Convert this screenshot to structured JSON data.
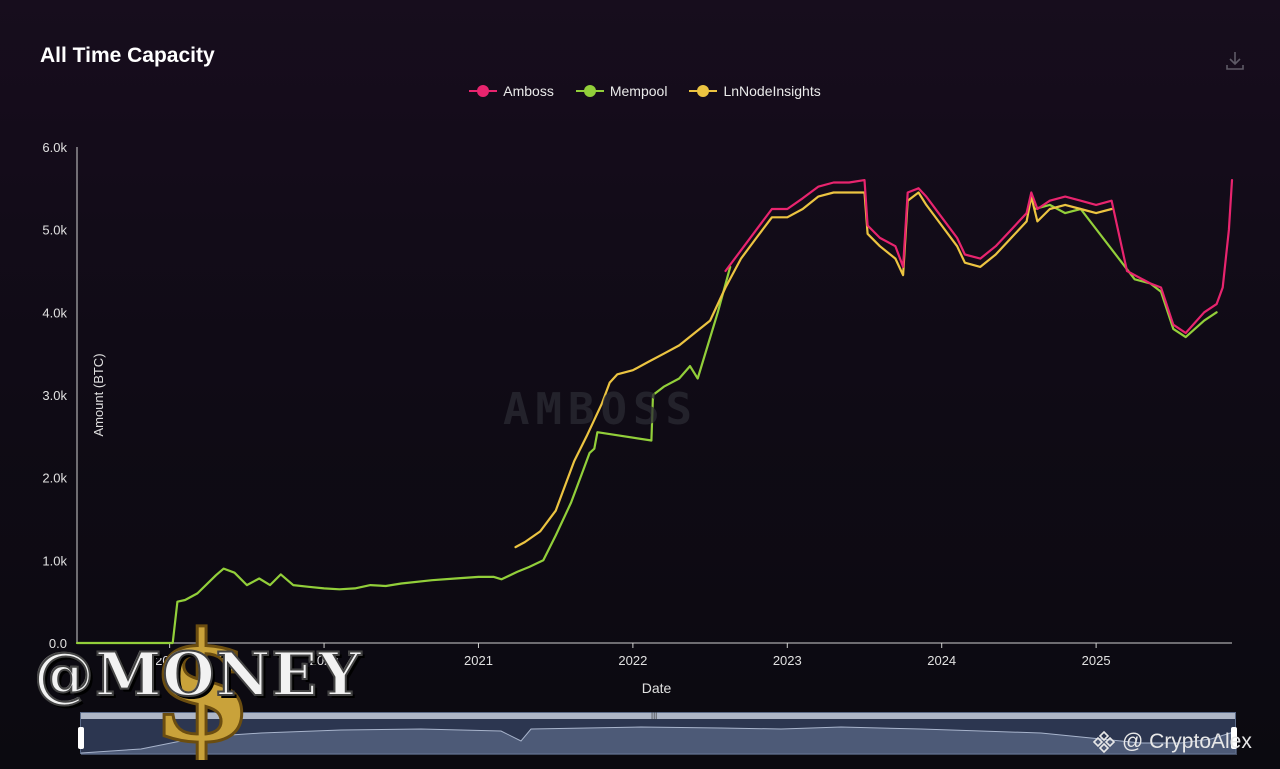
{
  "title": "All Time Capacity",
  "download_icon": "download-icon",
  "legend": [
    {
      "name": "Amboss",
      "color": "#e8246e"
    },
    {
      "name": "Mempool",
      "color": "#92cf3a"
    },
    {
      "name": "LnNodeInsights",
      "color": "#ecc441"
    }
  ],
  "chart_data": {
    "type": "line",
    "title": "All Time Capacity",
    "xlabel": "Date",
    "ylabel": "Amount (BTC)",
    "ylim": [
      0,
      6000
    ],
    "xlim": [
      2018.4,
      2025.88
    ],
    "y_ticks": [
      "0.0",
      "1.0k",
      "2.0k",
      "3.0k",
      "4.0k",
      "5.0k",
      "6.0k"
    ],
    "x_ticks": [
      "2019",
      "2020",
      "2021",
      "2022",
      "2023",
      "2024",
      "2025"
    ],
    "legend_position": "top-center",
    "grid": false,
    "series": [
      {
        "name": "Mempool",
        "color": "#92cf3a",
        "points": [
          [
            2018.4,
            0
          ],
          [
            2018.9,
            0
          ],
          [
            2019.02,
            0
          ],
          [
            2019.05,
            500
          ],
          [
            2019.1,
            520
          ],
          [
            2019.18,
            600
          ],
          [
            2019.3,
            820
          ],
          [
            2019.35,
            900
          ],
          [
            2019.42,
            850
          ],
          [
            2019.5,
            700
          ],
          [
            2019.58,
            780
          ],
          [
            2019.65,
            700
          ],
          [
            2019.72,
            830
          ],
          [
            2019.8,
            700
          ],
          [
            2019.9,
            680
          ],
          [
            2020.0,
            660
          ],
          [
            2020.1,
            650
          ],
          [
            2020.2,
            660
          ],
          [
            2020.3,
            700
          ],
          [
            2020.4,
            690
          ],
          [
            2020.5,
            720
          ],
          [
            2020.7,
            760
          ],
          [
            2020.85,
            780
          ],
          [
            2021.0,
            800
          ],
          [
            2021.1,
            800
          ],
          [
            2021.15,
            770
          ],
          [
            2021.25,
            860
          ],
          [
            2021.33,
            920
          ],
          [
            2021.42,
            1000
          ],
          [
            2021.5,
            1300
          ],
          [
            2021.6,
            1700
          ],
          [
            2021.68,
            2100
          ],
          [
            2021.72,
            2300
          ],
          [
            2021.75,
            2350
          ],
          [
            2021.77,
            2550
          ],
          [
            2022.12,
            2450
          ],
          [
            2022.13,
            3000
          ],
          [
            2022.2,
            3100
          ],
          [
            2022.3,
            3200
          ],
          [
            2022.37,
            3350
          ],
          [
            2022.42,
            3200
          ],
          [
            2022.55,
            4000
          ],
          [
            2022.63,
            4550
          ]
        ]
      },
      {
        "name": "Mempool",
        "color": "#92cf3a",
        "points": [
          [
            2024.6,
            5250
          ],
          [
            2024.7,
            5300
          ],
          [
            2024.8,
            5200
          ],
          [
            2024.9,
            5250
          ],
          [
            2025.25,
            4400
          ],
          [
            2025.35,
            4350
          ],
          [
            2025.42,
            4250
          ],
          [
            2025.5,
            3800
          ],
          [
            2025.58,
            3700
          ],
          [
            2025.7,
            3900
          ],
          [
            2025.78,
            4000
          ]
        ]
      },
      {
        "name": "LnNodeInsights",
        "color": "#ecc441",
        "points": [
          [
            2021.24,
            1160
          ],
          [
            2021.3,
            1220
          ],
          [
            2021.4,
            1350
          ],
          [
            2021.5,
            1600
          ],
          [
            2021.62,
            2200
          ],
          [
            2021.7,
            2500
          ],
          [
            2021.75,
            2700
          ],
          [
            2021.8,
            2900
          ],
          [
            2021.85,
            3150
          ],
          [
            2021.9,
            3250
          ],
          [
            2022.0,
            3300
          ],
          [
            2022.1,
            3400
          ],
          [
            2022.2,
            3500
          ],
          [
            2022.3,
            3600
          ],
          [
            2022.4,
            3750
          ],
          [
            2022.5,
            3900
          ],
          [
            2022.6,
            4300
          ],
          [
            2022.7,
            4650
          ],
          [
            2022.8,
            4900
          ],
          [
            2022.9,
            5150
          ],
          [
            2023.0,
            5150
          ],
          [
            2023.1,
            5250
          ],
          [
            2023.2,
            5400
          ],
          [
            2023.3,
            5450
          ],
          [
            2023.4,
            5450
          ],
          [
            2023.5,
            5450
          ],
          [
            2023.52,
            4950
          ],
          [
            2023.6,
            4800
          ],
          [
            2023.7,
            4650
          ],
          [
            2023.75,
            4450
          ],
          [
            2023.78,
            5350
          ],
          [
            2023.85,
            5450
          ],
          [
            2023.9,
            5300
          ],
          [
            2024.0,
            5050
          ],
          [
            2024.1,
            4800
          ],
          [
            2024.15,
            4600
          ],
          [
            2024.25,
            4550
          ],
          [
            2024.35,
            4700
          ],
          [
            2024.45,
            4900
          ],
          [
            2024.55,
            5100
          ],
          [
            2024.58,
            5400
          ],
          [
            2024.62,
            5100
          ],
          [
            2024.7,
            5250
          ],
          [
            2024.8,
            5300
          ],
          [
            2024.9,
            5250
          ],
          [
            2025.0,
            5200
          ],
          [
            2025.1,
            5250
          ]
        ]
      },
      {
        "name": "Amboss",
        "color": "#e8246e",
        "points": [
          [
            2022.6,
            4500
          ],
          [
            2022.7,
            4750
          ],
          [
            2022.8,
            5000
          ],
          [
            2022.9,
            5250
          ],
          [
            2023.0,
            5250
          ],
          [
            2023.1,
            5380
          ],
          [
            2023.2,
            5520
          ],
          [
            2023.3,
            5570
          ],
          [
            2023.4,
            5570
          ],
          [
            2023.5,
            5600
          ],
          [
            2023.52,
            5050
          ],
          [
            2023.6,
            4900
          ],
          [
            2023.7,
            4800
          ],
          [
            2023.75,
            4550
          ],
          [
            2023.78,
            5450
          ],
          [
            2023.85,
            5500
          ],
          [
            2023.9,
            5400
          ],
          [
            2024.0,
            5150
          ],
          [
            2024.1,
            4900
          ],
          [
            2024.15,
            4700
          ],
          [
            2024.25,
            4650
          ],
          [
            2024.35,
            4800
          ],
          [
            2024.45,
            5000
          ],
          [
            2024.55,
            5200
          ],
          [
            2024.58,
            5450
          ],
          [
            2024.62,
            5250
          ],
          [
            2024.7,
            5350
          ],
          [
            2024.8,
            5400
          ],
          [
            2024.9,
            5350
          ],
          [
            2025.0,
            5300
          ],
          [
            2025.1,
            5350
          ],
          [
            2025.2,
            4500
          ],
          [
            2025.35,
            4350
          ],
          [
            2025.42,
            4300
          ],
          [
            2025.5,
            3850
          ],
          [
            2025.58,
            3750
          ],
          [
            2025.7,
            4000
          ],
          [
            2025.78,
            4100
          ],
          [
            2025.82,
            4300
          ],
          [
            2025.86,
            5000
          ],
          [
            2025.88,
            5600
          ]
        ]
      }
    ]
  },
  "watermark": "AMBOSS",
  "overlay_logo": "@MONEY",
  "credit": "@ CryptoAlex"
}
